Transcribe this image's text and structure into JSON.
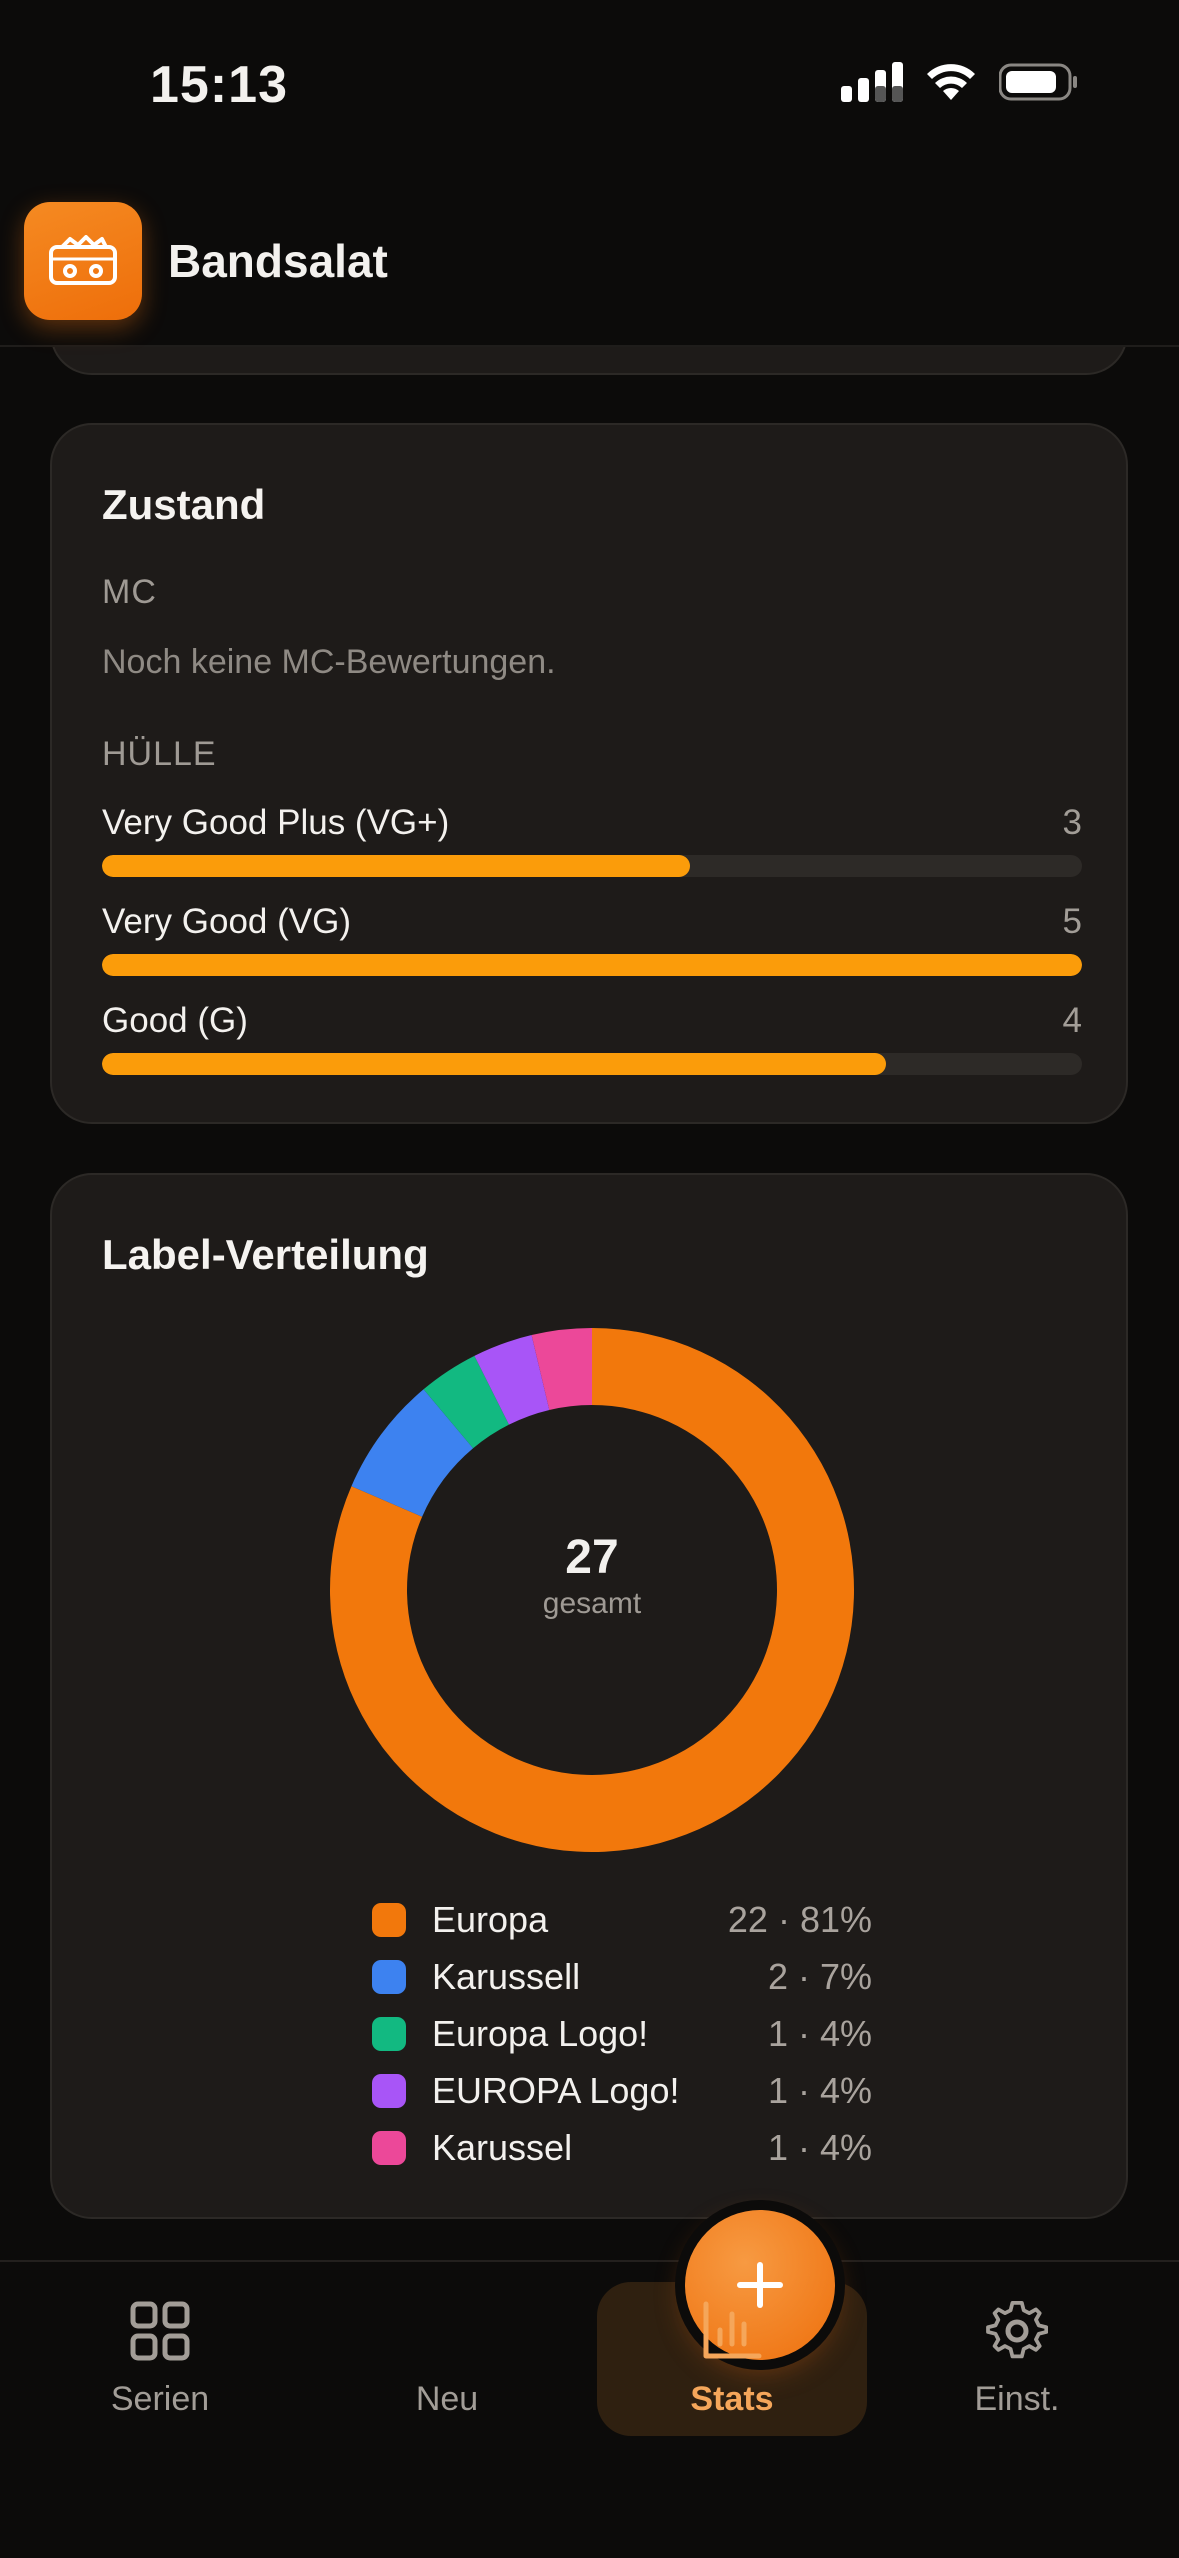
{
  "status_bar": {
    "time": "15:13"
  },
  "app": {
    "title": "Bandsalat"
  },
  "zustand": {
    "title": "Zustand",
    "mc_label": "MC",
    "mc_empty": "Noch keine MC-Bewertungen.",
    "huelle_label": "HÜLLE",
    "bars": [
      {
        "label": "Very Good Plus (VG+)",
        "count": "3",
        "fraction": 0.6
      },
      {
        "label": "Very Good (VG)",
        "count": "5",
        "fraction": 1.0
      },
      {
        "label": "Good (G)",
        "count": "4",
        "fraction": 0.8
      }
    ]
  },
  "label_dist": {
    "title": "Label-Verteilung",
    "total": "27",
    "total_label": "gesamt"
  },
  "chart_data": {
    "type": "pie",
    "title": "Label-Verteilung",
    "categories": [
      "Europa",
      "Karussell",
      "Europa Logo!",
      "EUROPA Logo!",
      "Karussel"
    ],
    "values": [
      22,
      2,
      1,
      1,
      1
    ],
    "percent_labels": [
      "22 · 81%",
      "2 · 7%",
      "1 · 4%",
      "1 · 4%",
      "1 · 4%"
    ],
    "colors": [
      "#f2780c",
      "#3d82f0",
      "#12b981",
      "#a855f7",
      "#ec4899"
    ],
    "total": 27,
    "center_text": "27",
    "center_subtext": "gesamt"
  },
  "tabs": [
    {
      "label": "Serien",
      "icon": "grid-icon"
    },
    {
      "label": "Neu",
      "icon": "plus-icon"
    },
    {
      "label": "Stats",
      "icon": "bar-chart-icon",
      "active": true
    },
    {
      "label": "Einst.",
      "icon": "gear-icon"
    }
  ],
  "colors": {
    "accent": "#fb9c0a",
    "brand": "#f2780c",
    "active_tab": "#f5a65a"
  }
}
